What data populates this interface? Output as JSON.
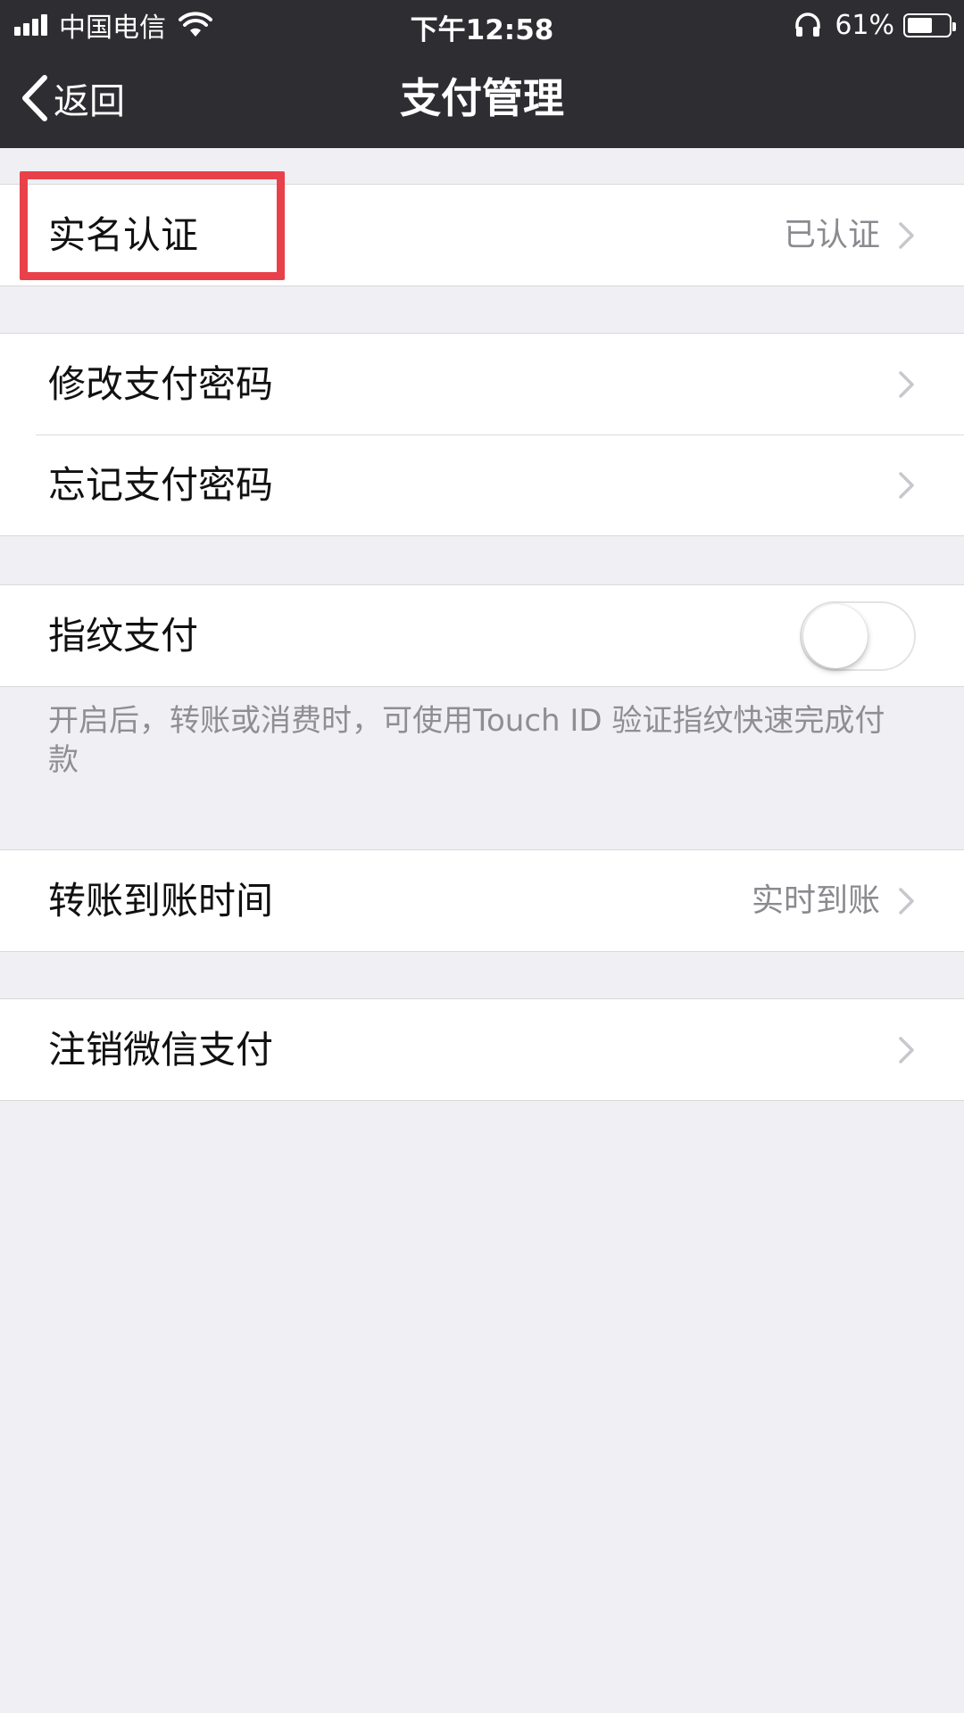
{
  "status_bar": {
    "carrier": "中国电信",
    "time": "下午12:58",
    "battery_percent": "61%",
    "battery_level": 0.61,
    "icons": [
      "signal-icon",
      "wifi-icon",
      "headphones-icon",
      "battery-icon"
    ]
  },
  "navbar": {
    "back_label": "返回",
    "title": "支付管理"
  },
  "sections": {
    "identity": {
      "label": "实名认证",
      "value": "已认证"
    },
    "password": {
      "change_label": "修改支付密码",
      "forgot_label": "忘记支付密码"
    },
    "fingerprint": {
      "label": "指纹支付",
      "enabled": false,
      "note": "开启后，转账或消费时，可使用Touch ID 验证指纹快速完成付款"
    },
    "transfer": {
      "label": "转账到账时间",
      "value": "实时到账"
    },
    "cancel": {
      "label": "注销微信支付"
    }
  },
  "colors": {
    "topbar": "#2e2e32",
    "background": "#efeff4",
    "highlight": "#e8414a",
    "secondary_text": "#8a8a8f"
  }
}
